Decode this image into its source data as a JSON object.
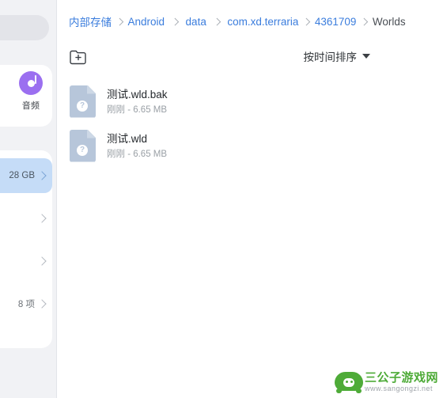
{
  "sidebar": {
    "search": {
      "name": "search-pill",
      "value": ""
    },
    "category_card": {
      "tiles": [
        {
          "icon": "music-note-icon",
          "label": "音频"
        }
      ]
    },
    "nav_rows": [
      {
        "meta": "28 GB",
        "selected": true,
        "chevron": "chevron-right-icon"
      },
      {
        "meta": "",
        "selected": false,
        "chevron": "chevron-right-icon"
      },
      {
        "meta": "",
        "selected": false,
        "chevron": "chevron-right-icon"
      },
      {
        "meta": "8 项",
        "selected": false,
        "chevron": "chevron-right-icon"
      }
    ]
  },
  "breadcrumb": {
    "items": [
      {
        "label": "内部存储",
        "current": false
      },
      {
        "label": "Android",
        "current": false
      },
      {
        "label": "data",
        "current": false
      },
      {
        "label": "com.xd.terraria",
        "current": false
      },
      {
        "label": "4361709",
        "current": false
      },
      {
        "label": "Worlds",
        "current": true
      }
    ]
  },
  "toolbar": {
    "new_folder_icon": "new-folder-icon",
    "sort_label": "按时间排序",
    "sort_caret": "caret-down-icon"
  },
  "files": [
    {
      "name": "测试.wld.bak",
      "meta": "刚刚 - 6.65 MB",
      "icon": "unknown-file-icon"
    },
    {
      "name": "测试.wld",
      "meta": "刚刚 - 6.65 MB",
      "icon": "unknown-file-icon"
    }
  ],
  "watermark": {
    "title": "三公子游戏网",
    "url": "www.sangongzi.net",
    "logo": "turtle-logo-icon"
  },
  "colors": {
    "link": "#3b7ddd",
    "selected_row": "#c5dcf7",
    "audio_accent": "#9b6ff0",
    "sidebar_bg": "#f1f2f5",
    "watermark_green": "#4eab38"
  }
}
